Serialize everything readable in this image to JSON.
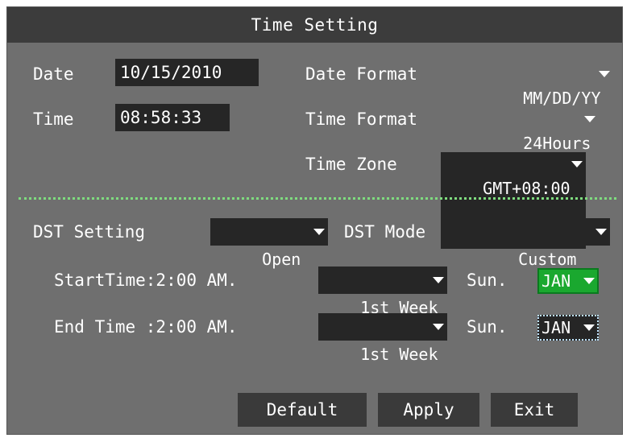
{
  "window": {
    "title": "Time Setting"
  },
  "date": {
    "label": "Date",
    "value": "10/15/2010"
  },
  "time": {
    "label": "Time",
    "value": "08:58:33"
  },
  "date_format": {
    "label": "Date Format",
    "value": "MM/DD/YY"
  },
  "time_format": {
    "label": "Time Format",
    "value": "24Hours"
  },
  "time_zone": {
    "label": "Time Zone",
    "value": "GMT+08:00"
  },
  "dst": {
    "setting_label": "DST Setting",
    "setting_value": "Open",
    "mode_label": "DST Mode",
    "mode_value": "Custom",
    "start": {
      "label": "StartTime:2:00 AM.",
      "week": "1st Week",
      "day": "Sun.",
      "month": "JAN"
    },
    "end": {
      "label": "End Time :2:00 AM.",
      "week": "1st Week",
      "day": "Sun.",
      "month": "JAN"
    }
  },
  "buttons": {
    "default": "Default",
    "apply": "Apply",
    "exit": "Exit"
  },
  "colors": {
    "background": "#6f6f6f",
    "titlebar": "#3c3c3c",
    "field": "#262626",
    "divider": "#7fdc7f",
    "focus_green": "#1aa82f"
  }
}
